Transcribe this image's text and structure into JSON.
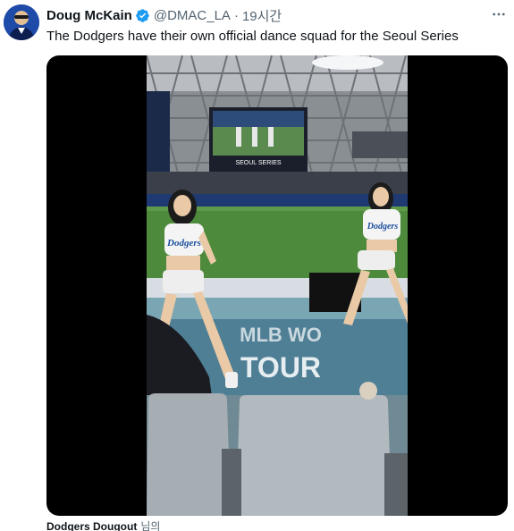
{
  "tweet": {
    "author": {
      "display_name": "Doug McKain",
      "handle": "@DMAC_LA",
      "verified": true,
      "avatar_icon": "profile-photo"
    },
    "separator": "·",
    "timestamp": "19시간",
    "text": "The Dodgers have their own official dance squad for the Seoul Series",
    "more_icon": "more-horizontal-icon",
    "media": {
      "type": "video",
      "scoreboard_caption": "SEOUL SERIES",
      "floor_text_line1": "MLB WO",
      "floor_text_line2": "TOUR",
      "jersey_text": "Dodgers"
    },
    "source": {
      "name": "Dodgers Dougout",
      "suffix": "님의"
    }
  },
  "colors": {
    "verified_blue": "#1d9bf0",
    "secondary_text": "#536471",
    "primary_text": "#0f1419",
    "media_background": "#000000"
  }
}
